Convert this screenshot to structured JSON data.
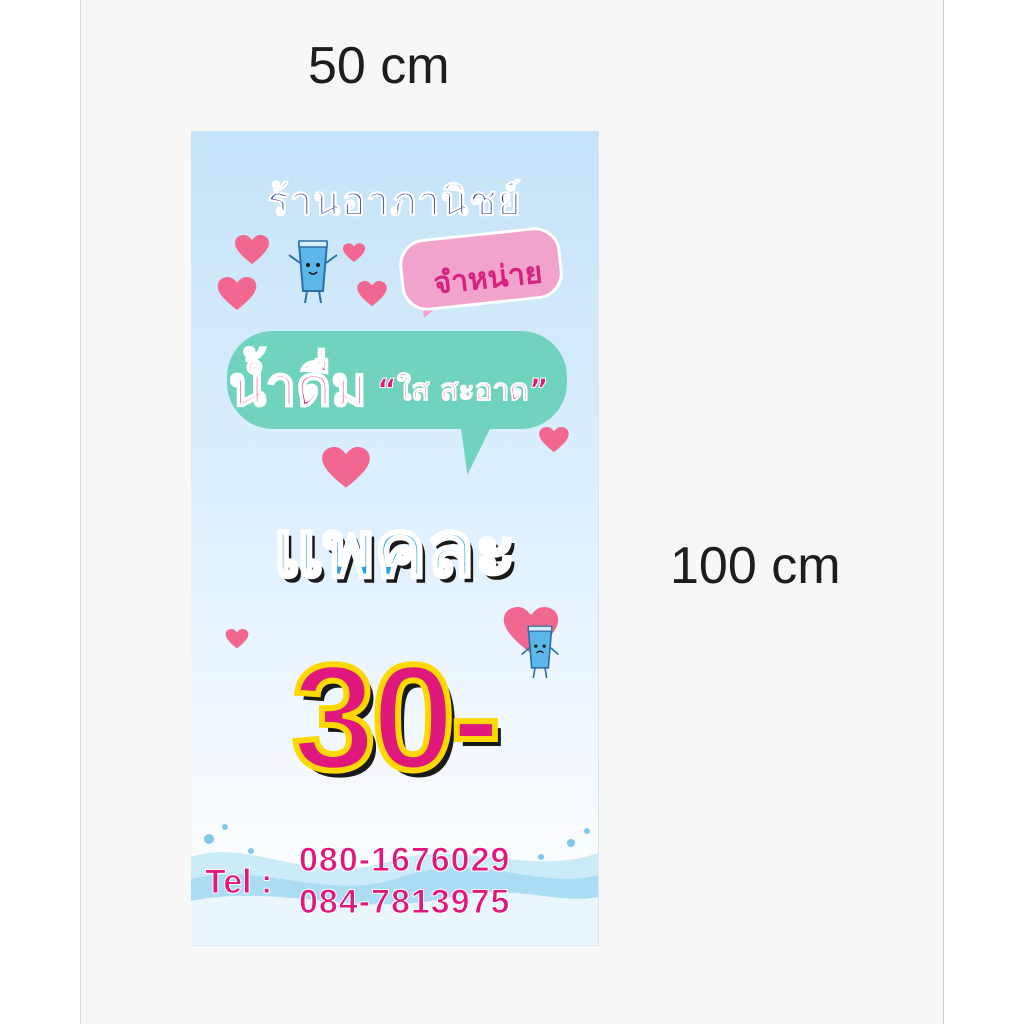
{
  "dimensions": {
    "width_label": "50 cm",
    "height_label": "100 cm"
  },
  "banner": {
    "shop_name": "ร้านอาภานิชย์",
    "sell_label": "จำหน่าย",
    "product_label": "น้ำดื่ม",
    "quality_label": "“ใส สะอาด”",
    "pack_label": "แพคละ",
    "price": "30-",
    "tel_label": "Tel :",
    "phones": [
      "080-1676029",
      "084-7813975"
    ]
  },
  "colors": {
    "pink": "#e0177c",
    "blue": "#2d9ee3",
    "navy": "#2d3a9b",
    "teal": "#6fd3be",
    "yellow": "#ffd800"
  },
  "icons": [
    "heart-icon",
    "water-cup-mascot-icon",
    "water-splash-icon"
  ]
}
